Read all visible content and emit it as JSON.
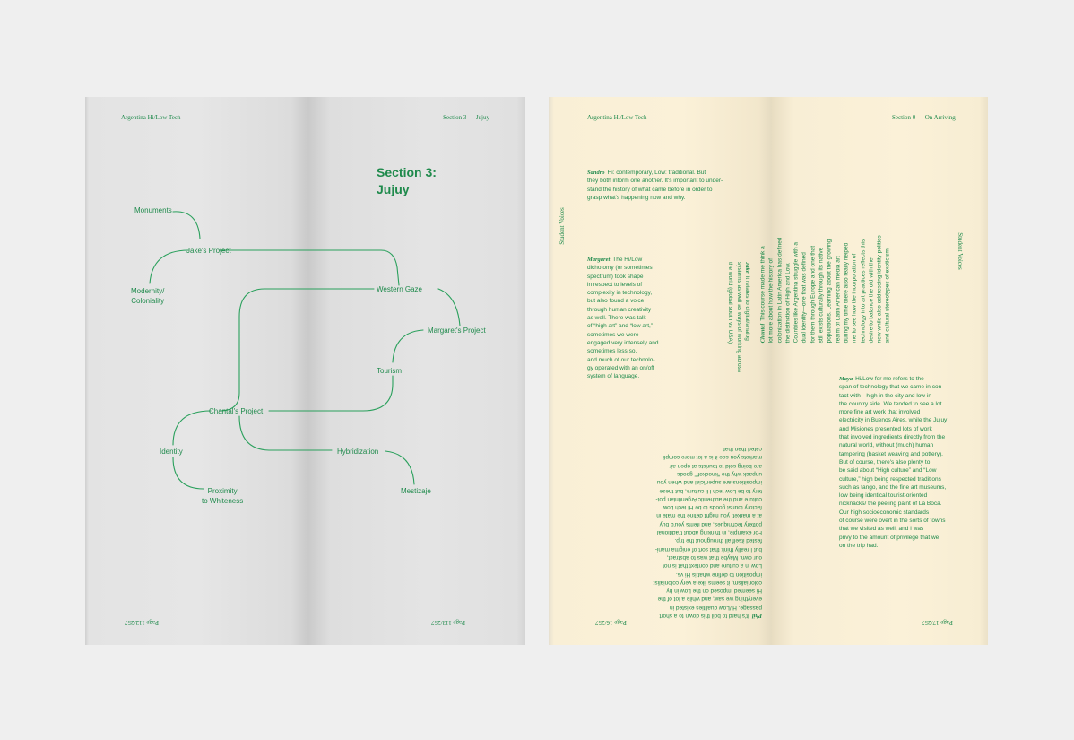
{
  "left_spread": {
    "header_left": "Argentina Hi/Low Tech",
    "header_right": "Section 3 — Jujuy",
    "section_title_line1": "Section 3:",
    "section_title_line2": "Jujuy",
    "page_left": "Page 112/257",
    "page_right": "Page 113/257",
    "nodes": {
      "monuments": "Monuments",
      "jakes_project": "Jake's Project",
      "modernity": "Modernity/\nColoniality",
      "western_gaze": "Western Gaze",
      "margarets_project": "Margaret's Project",
      "tourism": "Tourism",
      "chantals_project": "Chantal's Project",
      "identity": "Identity",
      "hybridization": "Hybridization",
      "mestizaje": "Mestizaje",
      "proximity": "Proximity\nto Whiteness"
    }
  },
  "right_spread": {
    "header_left": "Argentina Hi/Low Tech",
    "header_right": "Section 0 — On Arriving",
    "side_label_left": "Student Voices",
    "side_label_right": "Student Voices",
    "page_left": "Page 16/257",
    "page_right": "Page 17/257",
    "sandro_name": "Sandro",
    "sandro_text": "Hi: contemporary, Low: traditional. But\nthey both inform one another. It's important to under-\nstand the history of what came before in order to\ngrasp what's happening now and why.",
    "margaret_name": "Margaret",
    "margaret_text": "The Hi/Low\ndichotomy (or sometimes\nspectrum) took shape\nin respect to levels of\ncomplexity in technology,\nbut also found a voice\nthrough human creativity\nas well. There was talk\nof “high art” and “low art,”\nsometimes we were\nengaged very intensely and\nsometimes less so,\nand much of our technolo-\ngy operated with an on/off\nsystem of language.",
    "jake_name": "Jake",
    "jake_text": "It relates to digital/analog\nsystems as well as ways of working across\nthe world (global south vs USA)",
    "chantal_name": "Chantal",
    "chantal_text": "This course made me think a\nlot more about how the history of\ncolonization in Latin America has defined\nthe distinction of High and Low.\nCountries like Argentina struggle with a\ndual identity—one that was defined\nfor them through Europe and one that\nstill exists culturally through its native\npopulations. Learning about the growing\nrealm of Latin American media art\nduring my time there also really helped\nme to see how the incorporation of\ntechnology into art practices reflects this\ndesire to balance the old with the\nnew while also addressing identity politics\nand cultural stereotypes of exoticism.",
    "maya_name": "Maya",
    "maya_text": "Hi/Low for me refers to the\nspan of technology that we came in con-\ntact with—high in the city and low in\n the country side. We tended to see a lot\nmore fine art work that involved\nelectricity in Buenos Aires, while the Jujuy\nand Misiones presented lots of work\nthat involved ingredients directly from the\n natural world, without (much) human\ntampering (basket weaving and pottery).\nBut of course, there's also plenty to\nbe said about “High culture” and “Low\nculture,” high being respected traditions\nsuch as tango, and the fine art museums,\nlow being identical tourist-oriented\nnicknacks/ the peeling paint of La Boca.\nOur high socioeconomic standards\nof course were overt in the sorts of towns\nthat we visited as well, and I was\nprivy to the amount of privilege that we\non the trip had.",
    "phil_name": "Phil",
    "phil_text": "It's hard to boil this down to a short\npassage. Hi/Low dualities existed in\neverything we saw, and while a lot of the\nHi seemed imposed on the Low in by\ncolonialism, it seems like a very colonialist\nimposition to define what is Hi vs.\nLow in a culture and context that is not\nour own. Maybe that was to abstract,\nbut I really think that sort of enigma mani-\nfested itself all throughout the trip.\nFor example, in thinking about traditional\npottery techniques, and items you'd buy\nat a market, you might define the mate in\nfactory tourist goods to be Hi tech Low\nculture and the authentic Argentinian pot-\ntery to be Low tech Hi culture, but these\nimpositions are superficial and when you\nunpack why the “knockoff” goods\nare being sold to tourists at open air\nmarkets you see it is a lot more compli-\ncated than that."
  }
}
